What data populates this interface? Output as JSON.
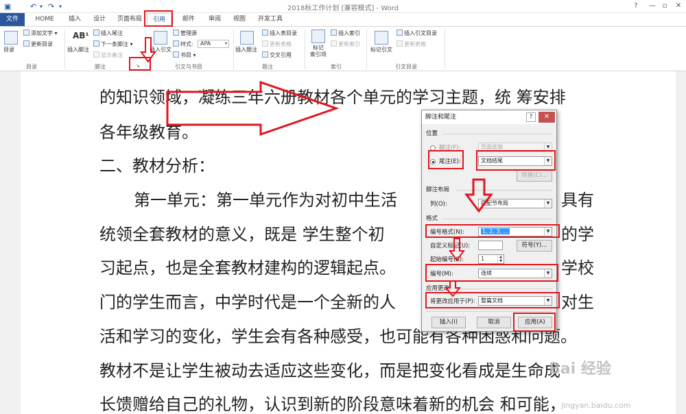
{
  "window": {
    "title": "2018秋工作计划 [兼容模式] - Word",
    "help": "?",
    "minimize": "—",
    "restore": "▫",
    "close": "✕"
  },
  "tabs": [
    "文件",
    "HOME",
    "插入",
    "设计",
    "页面布局",
    "引用",
    "邮件",
    "审阅",
    "视图",
    "开发工具"
  ],
  "ribbon": {
    "toc": {
      "big": "目录",
      "add_text": "添加文字 ▾",
      "update": "更新目录",
      "group": "目录"
    },
    "footnote": {
      "big": "插入脚注",
      "ab": "AB¹",
      "insert_endnote": "插入尾注",
      "next": "下一条脚注 ▾",
      "show": "显示备注",
      "group": "脚注",
      "launcher": "↘"
    },
    "citation": {
      "big": "插入引文",
      "manage": "管理源",
      "style_label": "样式:",
      "style_value": "APA",
      "bib": "书目 ▾",
      "group": "引文与书目"
    },
    "caption": {
      "big": "插入题注",
      "table_of_fig": "插入表目录",
      "update_table": "更新表格",
      "cross": "交叉引用",
      "group": "题注"
    },
    "index": {
      "big": "标记\n索引项",
      "insert": "插入索引",
      "update": "更新索引",
      "group": "索引"
    },
    "toa": {
      "big": "标记引文",
      "insert": "插入引文目录",
      "update": "更新表格",
      "group": "引文目录"
    }
  },
  "document": {
    "lines": [
      "的知识领域，凝练三年六册教材各个单元的学习主题，统  筹安排",
      "各年级教育。",
      "二、教材分析：",
      "第一单元：第一单元作为对初中生活",
      "统领全套教材的意义，既是   学生整个初",
      "习起点，也是全套教材建构的逻辑起点。",
      "门的学生而言，中学时代是一个全新的人",
      "活和学习的变化，学生会有各种感受，也可能有各种困惑和问题。",
      "教材不是让学生被动去适应这些变化，而是把变化看成是生命成",
      "长馈赠给自己的礼物，认识到新的阶段意味着新的机会    和可能，"
    ],
    "right_fragments": [
      "具有",
      "的学",
      "学校",
      "对生"
    ]
  },
  "dialog": {
    "title": "脚注和尾注",
    "help": "?",
    "close": "✕",
    "location": "位置",
    "footnote_radio": "脚注(F):",
    "footnote_value": "页面底端",
    "endnote_radio": "尾注(E):",
    "endnote_value": "文档结尾",
    "convert": "转换(C)...",
    "layout": "脚注布局",
    "columns_label": "列(O):",
    "columns_value": "匹配节布局",
    "format": "格式",
    "number_format_label": "编号格式(N):",
    "number_format_value": "1, 2, 3, ...",
    "custom_mark_label": "自定义标记(U):",
    "symbol_button": "符号(Y)...",
    "start_at_label": "起始编号(S):",
    "start_at_value": "1",
    "numbering_label": "编号(M):",
    "numbering_value": "连续",
    "apply_changes": "应用更改",
    "apply_to_label": "将更改应用于(P):",
    "apply_to_value": "整篇文档",
    "insert_button": "插入(I)",
    "cancel_button": "取消",
    "apply_button": "应用(A)"
  },
  "watermark": {
    "brand": "Bai 经验",
    "url": "jingyan.baidu.com"
  },
  "colors": {
    "accent": "#2b579a",
    "annotation": "#e0141e"
  }
}
